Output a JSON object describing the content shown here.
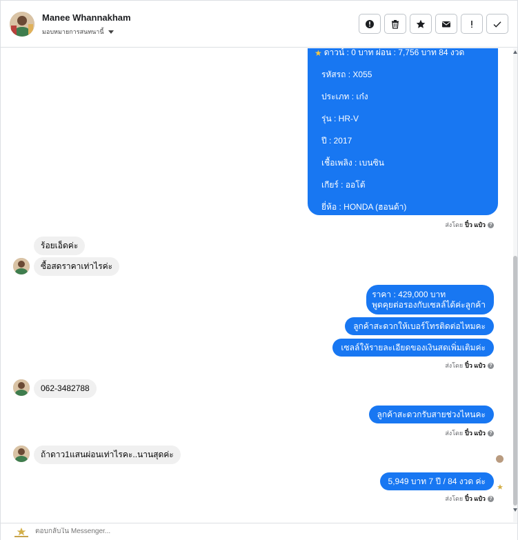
{
  "header": {
    "contact_name": "Manee Whannakham",
    "assign_label": "มอบหมายการสนทนานี้"
  },
  "actions": [
    {
      "name": "report-spam-button",
      "icon": "alert-circle-icon"
    },
    {
      "name": "delete-button",
      "icon": "trash-icon"
    },
    {
      "name": "star-button",
      "icon": "star-icon"
    },
    {
      "name": "mark-unread-button",
      "icon": "envelope-icon"
    },
    {
      "name": "follow-up-button",
      "icon": "exclamation-icon"
    },
    {
      "name": "mark-done-button",
      "icon": "check-icon"
    }
  ],
  "card": {
    "line_down": "ดาวน์ : 0 บาท ผ่อน : 7,756 บาท 84 งวด",
    "line_code": "รหัสรถ : X055",
    "line_type": "ประเภท : เก๋ง",
    "line_model": "รุ่น : HR-V",
    "line_year": "ปี : 2017",
    "line_fuel": "เชื้อเพลิง : เบนซิน",
    "line_gear": "เกียร์ : ออโต้",
    "line_brand": "ยี่ห้อ : HONDA (ฮอนด้า)"
  },
  "sent_by": {
    "prefix": "ส่งโดย",
    "name": "ปิ๋ว แป๋ว"
  },
  "messages": {
    "in_1": "ร้อยเอ็ดค่ะ",
    "in_2": "ซื้อสดราคาเท่าไรค่ะ",
    "out_price_1": "ราคา : 429,000 บาท",
    "out_price_2": "พูดคุยต่อรองกับเซลล์ได้ค่ะลูกค้า",
    "out_phone_ask": "ลูกค้าสะดวกให้เบอร์โทรติดต่อไหมคะ",
    "out_detail": "เซลล์ให้รายละเอียดของเงินสดเพิ่มเติมค่ะ",
    "in_phone": "062-3482788",
    "out_time": "ลูกค้าสะดวกรับสายช่วงไหนคะ",
    "in_down": "ถ้าดาว1แสนผ่อนเท่าไรคะ..นานสุดค่ะ",
    "out_installment": "5,949 บาท   7 ปี / 84 งวด  ค่ะ"
  },
  "composer": {
    "placeholder": "ตอบกลับใน Messenger..."
  },
  "colors": {
    "outgoing": "#1877f2",
    "incoming": "#f0f0f0",
    "star": "#f7c843"
  }
}
